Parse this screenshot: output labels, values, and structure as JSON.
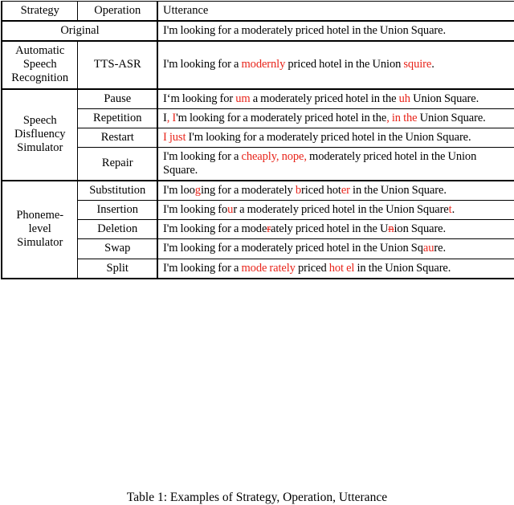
{
  "document": {
    "caption": "Table 1: Examples of Strategy, Operation, Utterance"
  },
  "table": {
    "headers": {
      "strategy": "Strategy",
      "operation": "Operation",
      "utterance": "Utterance"
    },
    "colors": {
      "error_highlight": "#e8241a",
      "text": "#000000",
      "rule": "#000000",
      "background": "#ffffff"
    },
    "groups": [
      {
        "strategy": "Original",
        "spanning_label": true,
        "rows": [
          {
            "operation": "",
            "utterance_plain": "I'm looking for a moderately priced hotel in the Union Square.",
            "utterance_parts": [
              {
                "t": "I'm looking for a moderately priced hotel in the Union Square.",
                "s": "n"
              }
            ]
          }
        ]
      },
      {
        "strategy": "Automatic Speech Recognition",
        "spanning_label": false,
        "rows": [
          {
            "operation": "TTS-ASR",
            "utterance_plain": "I'm looking for a modernly priced hotel in the Union squire.",
            "utterance_parts": [
              {
                "t": "I'm looking for a ",
                "s": "n"
              },
              {
                "t": "modernly",
                "s": "r"
              },
              {
                "t": " priced hotel in the Union ",
                "s": "n"
              },
              {
                "t": "squire",
                "s": "r"
              },
              {
                "t": ".",
                "s": "n"
              }
            ]
          }
        ]
      },
      {
        "strategy": "Speech Disfluency Simulator",
        "spanning_label": false,
        "rows": [
          {
            "operation": "Pause",
            "utterance_plain": "I‘m looking for um a moderately priced hotel in the uh Union Square.",
            "utterance_parts": [
              {
                "t": "I‘m looking for ",
                "s": "n"
              },
              {
                "t": "um",
                "s": "r"
              },
              {
                "t": " a moderately priced hotel in the ",
                "s": "n"
              },
              {
                "t": "uh",
                "s": "r"
              },
              {
                "t": " Union Square.",
                "s": "n"
              }
            ]
          },
          {
            "operation": "Repetition",
            "utterance_plain": "I, I'm looking for a moderately priced hotel in the, in the Union Square.",
            "utterance_parts": [
              {
                "t": "I",
                "s": "n"
              },
              {
                "t": ",",
                "s": "r"
              },
              {
                "t": " ",
                "s": "n"
              },
              {
                "t": "I",
                "s": "r"
              },
              {
                "t": "'m looking for a moderately priced hotel in the",
                "s": "n"
              },
              {
                "t": ", in the",
                "s": "r"
              },
              {
                "t": " Union Square.",
                "s": "n"
              }
            ]
          },
          {
            "operation": "Restart",
            "utterance_plain": "I just I'm looking for a moderately priced hotel in the Union Square.",
            "utterance_parts": [
              {
                "t": "I just",
                "s": "r"
              },
              {
                "t": " I'm looking for a moderately priced hotel in the Union Square.",
                "s": "n"
              }
            ]
          },
          {
            "operation": "Repair",
            "utterance_plain": "I'm looking for a cheaply, nope, moderately priced hotel in the Union Square.",
            "utterance_parts": [
              {
                "t": "I'm looking for a ",
                "s": "n"
              },
              {
                "t": "cheaply, nope,",
                "s": "r"
              },
              {
                "t": " moderately priced hotel in the Union Square.",
                "s": "n"
              }
            ]
          }
        ]
      },
      {
        "strategy": "Phoneme-level Simulator",
        "spanning_label": false,
        "rows": [
          {
            "operation": "Substitution",
            "utterance_plain": "I'm looging for a moderately briced hoter in the Union Square.",
            "utterance_parts": [
              {
                "t": "I'm loo",
                "s": "n"
              },
              {
                "t": "g",
                "s": "r"
              },
              {
                "t": "ing for a moderately ",
                "s": "n"
              },
              {
                "t": "b",
                "s": "r"
              },
              {
                "t": "riced hot",
                "s": "n"
              },
              {
                "t": "er",
                "s": "r"
              },
              {
                "t": " in the Union Square.",
                "s": "n"
              }
            ]
          },
          {
            "operation": "Insertion",
            "utterance_plain": "I'm looking four a moderately priced hotel in the Union Squaret.",
            "utterance_parts": [
              {
                "t": "I'm looking fo",
                "s": "n"
              },
              {
                "t": "u",
                "s": "r"
              },
              {
                "t": "r a moderately priced hotel in the Union Square",
                "s": "n"
              },
              {
                "t": "t",
                "s": "r"
              },
              {
                "t": ".",
                "s": "n"
              }
            ]
          },
          {
            "operation": "Deletion",
            "utterance_plain": "I'm looking for a moderately priced hotel in the Union Square.",
            "utterance_parts": [
              {
                "t": "I'm looking for a mode",
                "s": "n"
              },
              {
                "t": "r",
                "s": "d"
              },
              {
                "t": "ately priced hotel in the U",
                "s": "n"
              },
              {
                "t": "n",
                "s": "d"
              },
              {
                "t": "ion Square.",
                "s": "n"
              }
            ]
          },
          {
            "operation": "Swap",
            "utterance_plain": "I'm looking for a moderately priced hotel in the Union Sqaure.",
            "utterance_parts": [
              {
                "t": "I'm looking for a moderately priced hotel in the Union Sq",
                "s": "n"
              },
              {
                "t": "au",
                "s": "r"
              },
              {
                "t": "re.",
                "s": "n"
              }
            ]
          },
          {
            "operation": "Split",
            "utterance_plain": "I'm looking for a mode rately priced hot el in the Union Square.",
            "utterance_parts": [
              {
                "t": "I'm looking for a ",
                "s": "n"
              },
              {
                "t": "mode rately",
                "s": "r"
              },
              {
                "t": " priced ",
                "s": "n"
              },
              {
                "t": "hot el",
                "s": "r"
              },
              {
                "t": " in the Union Square.",
                "s": "n"
              }
            ]
          }
        ]
      }
    ]
  }
}
